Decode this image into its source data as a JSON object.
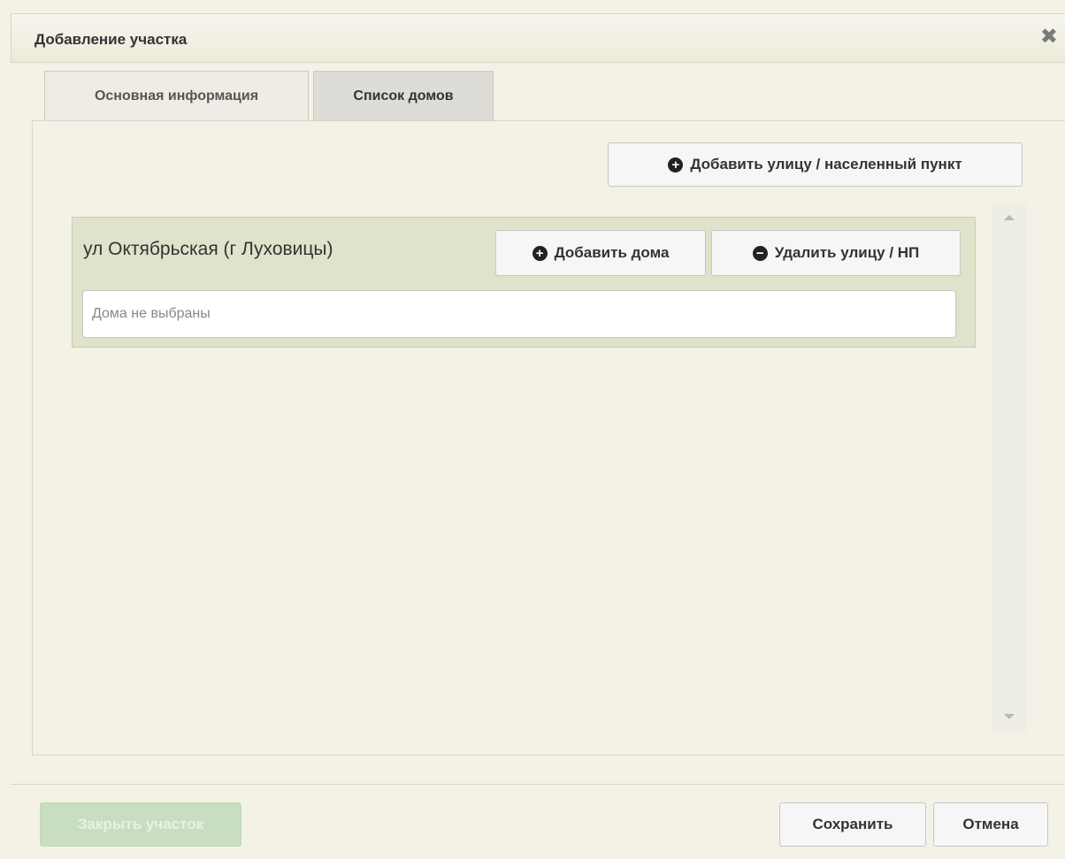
{
  "dialog": {
    "title": "Добавление участка",
    "close_icon": "close-icon"
  },
  "tabs": [
    {
      "label": "Основная информация",
      "active": false
    },
    {
      "label": "Список домов",
      "active": true
    }
  ],
  "toolbar": {
    "add_street_label": "Добавить улицу / населенный пункт",
    "add_street_icon": "plus-circle-icon"
  },
  "street": {
    "name": "ул Октябрьская (г Луховицы)",
    "add_houses_label": "Добавить дома",
    "remove_label": "Удалить улицу / НП",
    "houses_placeholder": "Дома не выбраны"
  },
  "footer": {
    "close_plot_label": "Закрыть участок",
    "save_label": "Сохранить",
    "cancel_label": "Отмена"
  },
  "colors": {
    "dialog_bg": "#f4f2e6",
    "street_panel_bg": "#dfe3cc",
    "disabled_button_bg": "#c9dec0"
  }
}
